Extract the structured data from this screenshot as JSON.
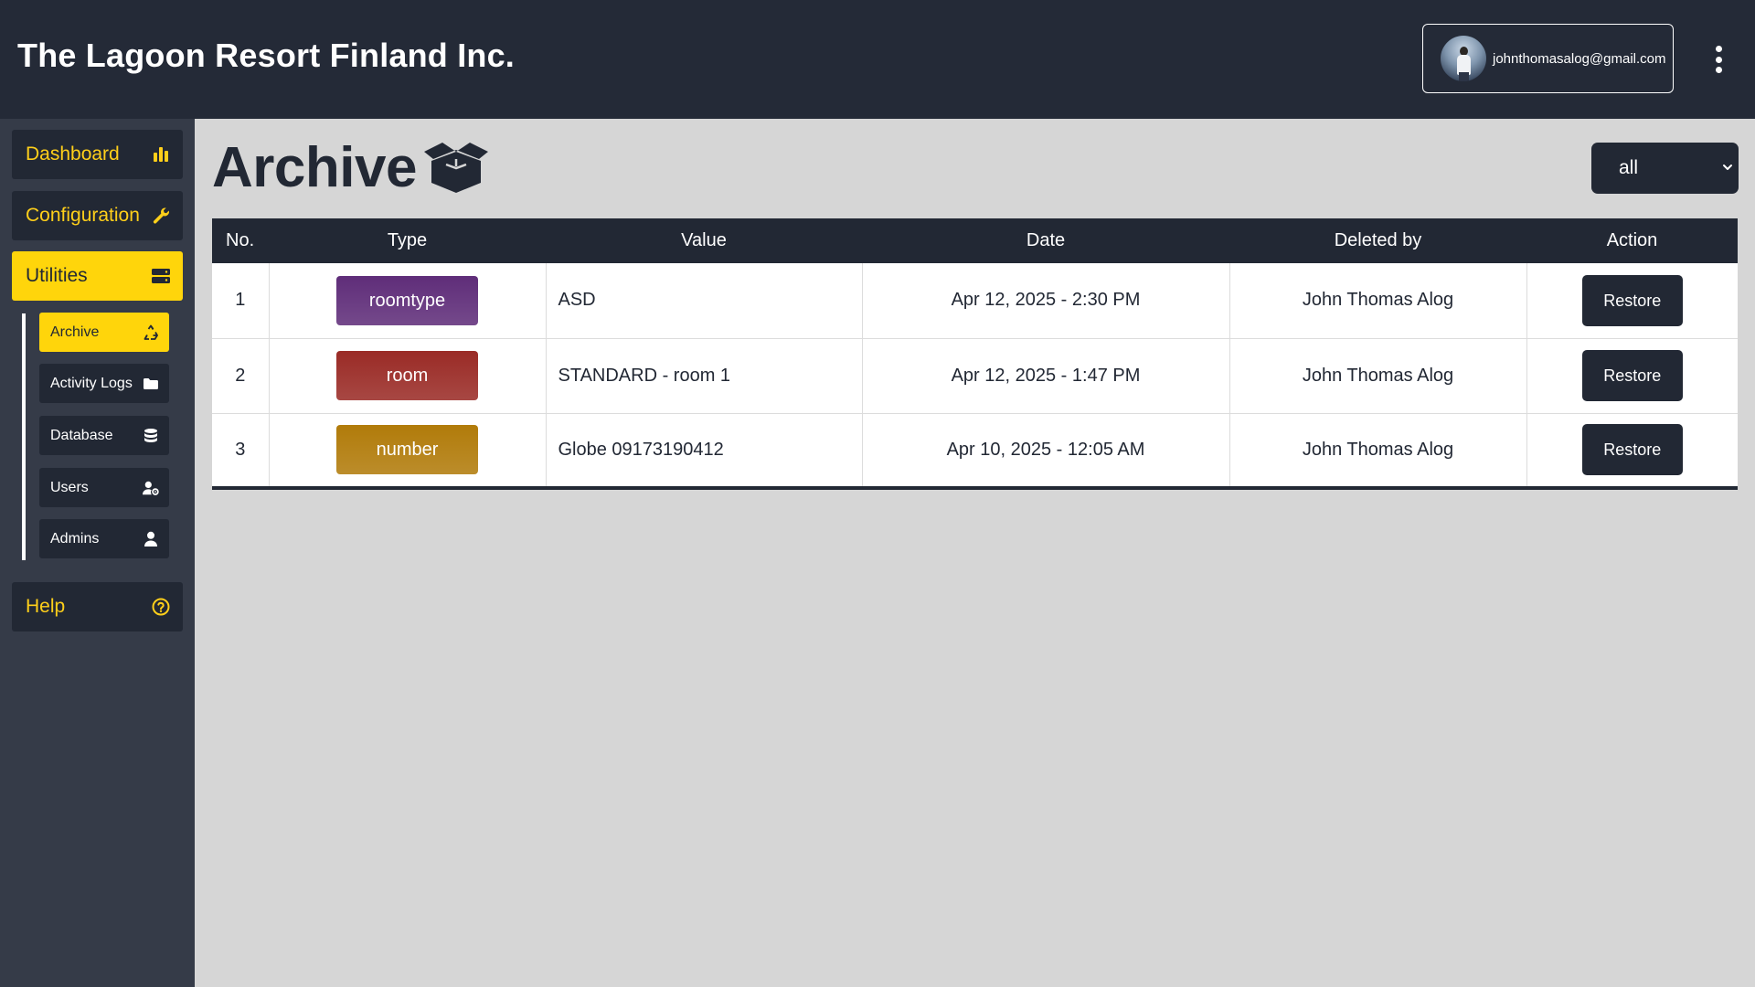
{
  "header": {
    "brand": "The Lagoon Resort Finland Inc.",
    "user_email": "johnthomasalog@gmail.com"
  },
  "sidebar": {
    "items": [
      {
        "label": "Dashboard",
        "icon": "bar-chart-icon"
      },
      {
        "label": "Configuration",
        "icon": "wrench-icon"
      },
      {
        "label": "Utilities",
        "icon": "server-icon"
      },
      {
        "label": "Help",
        "icon": "question-circle-icon"
      }
    ],
    "sub_items": [
      {
        "label": "Archive",
        "icon": "recycle-icon"
      },
      {
        "label": "Activity Logs",
        "icon": "folder-icon"
      },
      {
        "label": "Database",
        "icon": "database-icon"
      },
      {
        "label": "Users",
        "icon": "user-gear-icon"
      },
      {
        "label": "Admins",
        "icon": "user-icon"
      }
    ]
  },
  "main": {
    "title": "Archive",
    "title_icon": "box-open-icon",
    "filter": {
      "selected": "all"
    }
  },
  "table": {
    "columns": [
      "No.",
      "Type",
      "Value",
      "Date",
      "Deleted by",
      "Action"
    ],
    "rows": [
      {
        "no": "1",
        "type": "roomtype",
        "type_color": "#5f2d79",
        "value": "ASD",
        "date": "Apr 12, 2025 - 2:30 PM",
        "deleted_by": "John Thomas Alog",
        "action": "Restore"
      },
      {
        "no": "2",
        "type": "room",
        "type_color": "#9a2b26",
        "value": "STANDARD - room 1",
        "date": "Apr 12, 2025 - 1:47 PM",
        "deleted_by": "John Thomas Alog",
        "action": "Restore"
      },
      {
        "no": "3",
        "type": "number",
        "type_color": "#b17b0a",
        "value": "Globe 09173190412",
        "date": "Apr 10, 2025 - 12:05 AM",
        "deleted_by": "John Thomas Alog",
        "action": "Restore"
      }
    ]
  },
  "colors": {
    "header_bg": "#242a37",
    "sidebar_bg": "#353b48",
    "accent": "#ffd50b",
    "dark": "#222834",
    "content_bg": "#d6d6d6"
  }
}
